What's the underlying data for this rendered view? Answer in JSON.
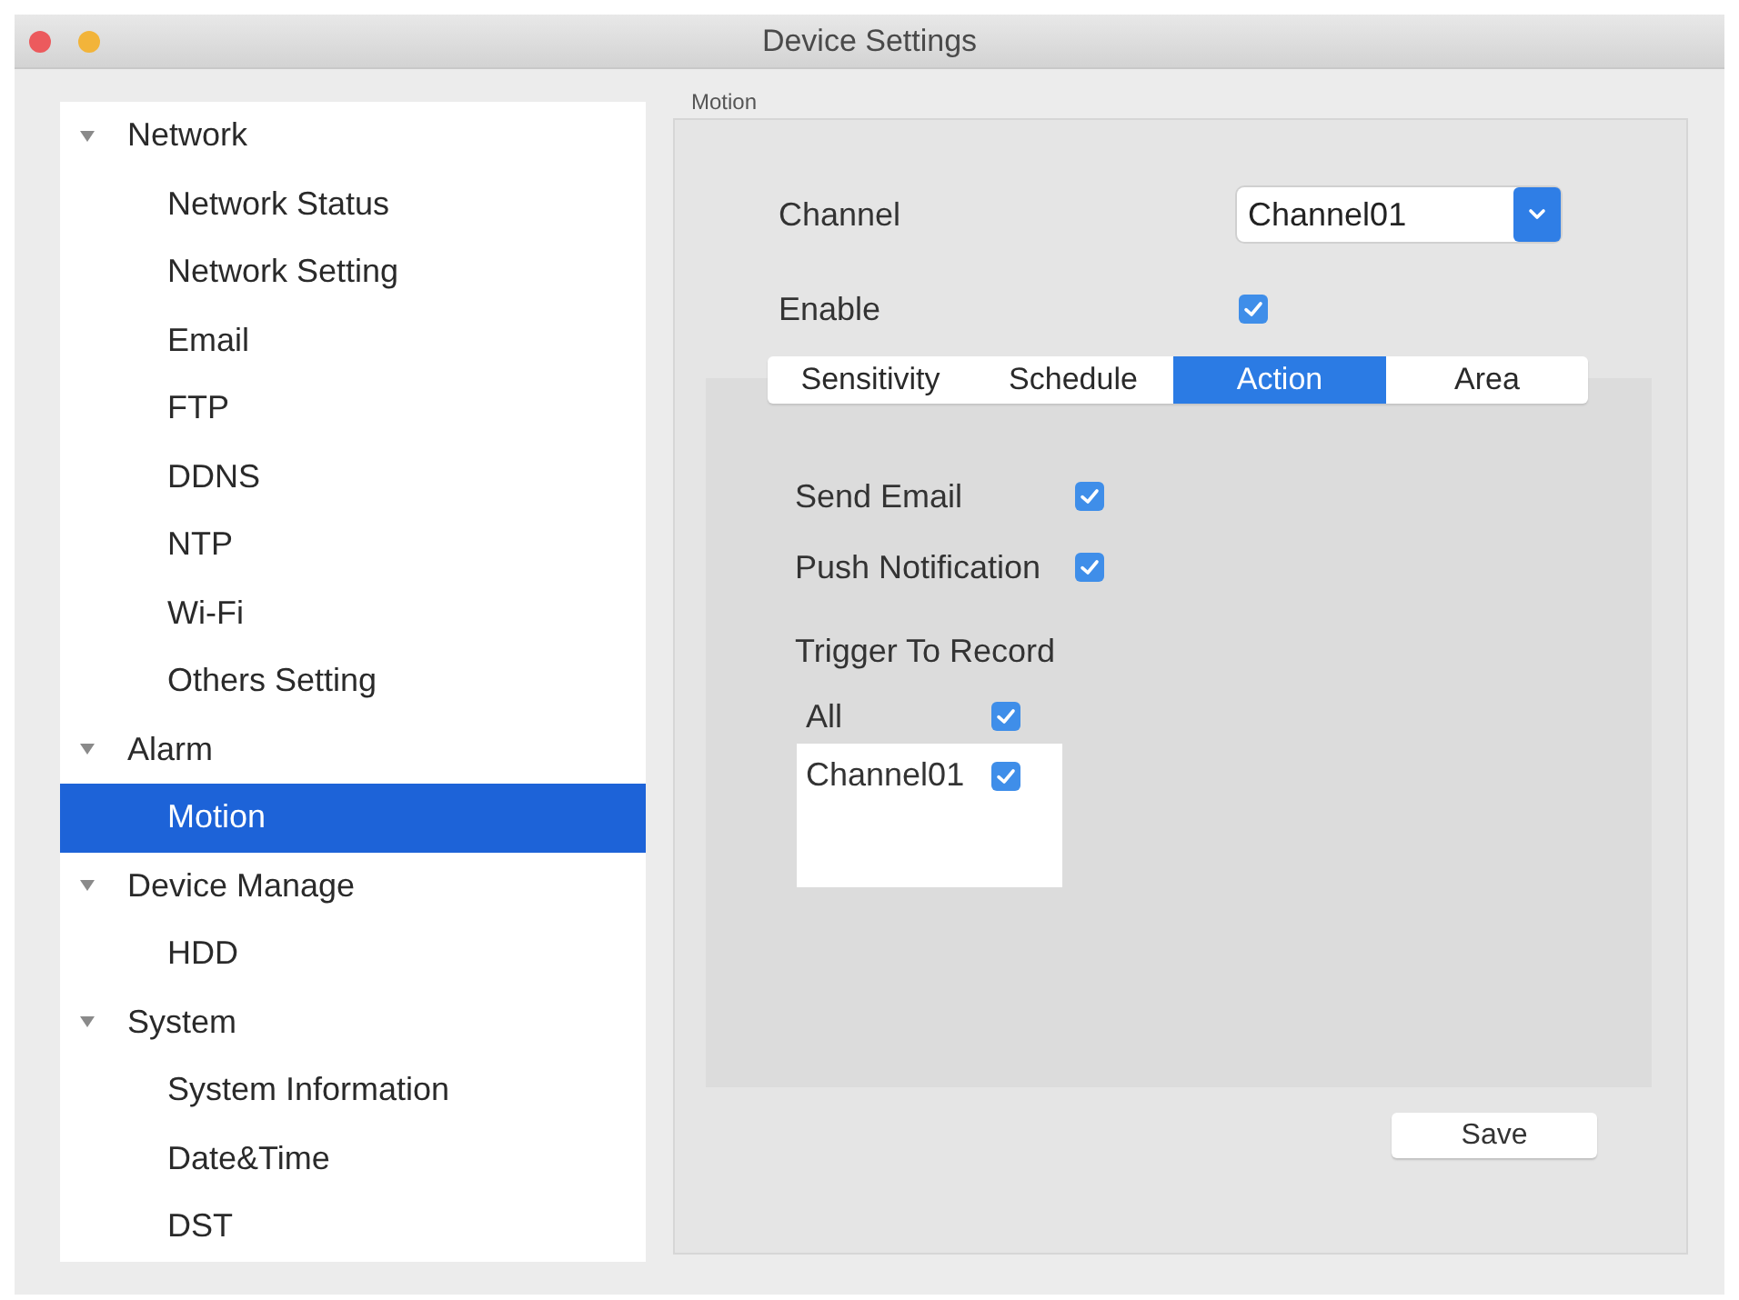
{
  "window": {
    "title": "Device Settings"
  },
  "sidebar": {
    "items": [
      {
        "label": "Network",
        "expanded": true,
        "selected": false,
        "children": [
          {
            "label": "Network Status",
            "selected": false
          },
          {
            "label": "Network Setting",
            "selected": false
          },
          {
            "label": "Email",
            "selected": false
          },
          {
            "label": "FTP",
            "selected": false
          },
          {
            "label": "DDNS",
            "selected": false
          },
          {
            "label": "NTP",
            "selected": false
          },
          {
            "label": "Wi-Fi",
            "selected": false
          },
          {
            "label": "Others Setting",
            "selected": false
          }
        ]
      },
      {
        "label": "Alarm",
        "expanded": true,
        "selected": false,
        "children": [
          {
            "label": "Motion",
            "selected": true
          }
        ]
      },
      {
        "label": "Device Manage",
        "expanded": true,
        "selected": false,
        "children": [
          {
            "label": "HDD",
            "selected": false
          }
        ]
      },
      {
        "label": "System",
        "expanded": true,
        "selected": false,
        "children": [
          {
            "label": "System Information",
            "selected": false
          },
          {
            "label": "Date&Time",
            "selected": false
          },
          {
            "label": "DST",
            "selected": false
          }
        ]
      }
    ]
  },
  "panel": {
    "title": "Motion",
    "channel": {
      "label": "Channel",
      "value": "Channel01"
    },
    "enable": {
      "label": "Enable",
      "checked": true
    },
    "tabs": [
      {
        "label": "Sensitivity",
        "selected": false
      },
      {
        "label": "Schedule",
        "selected": false
      },
      {
        "label": "Action",
        "selected": true
      },
      {
        "label": "Area",
        "selected": false
      }
    ],
    "notifications": [
      {
        "label": "Send Email",
        "checked": true
      },
      {
        "label": "Push Notification",
        "checked": true
      }
    ],
    "trigger": {
      "label": "Trigger To Record",
      "all": {
        "label": "All",
        "checked": true
      },
      "channels": [
        {
          "label": "Channel01",
          "checked": true
        }
      ]
    },
    "save_button": "Save"
  }
}
